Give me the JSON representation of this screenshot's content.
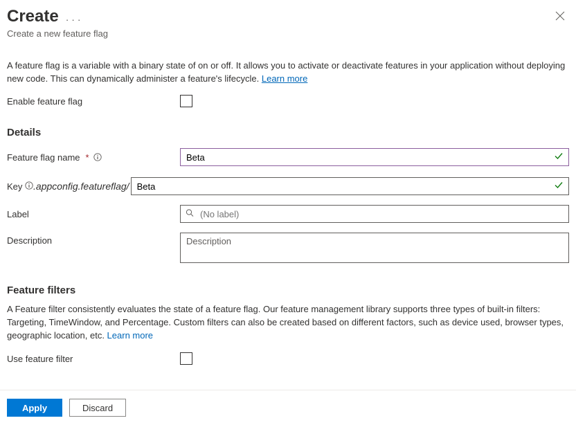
{
  "header": {
    "title": "Create",
    "subtitle": "Create a new feature flag"
  },
  "intro": {
    "text": "A feature flag is a variable with a binary state of on or off. It allows you to activate or deactivate features in your application without deploying new code. This can dynamically administer a feature's lifecycle. ",
    "learn_more": "Learn more"
  },
  "enable": {
    "label": "Enable feature flag"
  },
  "details": {
    "heading": "Details",
    "name": {
      "label": "Feature flag name",
      "value": "Beta"
    },
    "key": {
      "label": "Key",
      "prefix": ".appconfig.featureflag/",
      "value": "Beta"
    },
    "label_field": {
      "label": "Label",
      "placeholder": "(No label)"
    },
    "description": {
      "label": "Description",
      "placeholder": "Description"
    }
  },
  "filters": {
    "heading": "Feature filters",
    "text": "A Feature filter consistently evaluates the state of a feature flag. Our feature management library supports three types of built-in filters: Targeting, TimeWindow, and Percentage. Custom filters can also be created based on different factors, such as device used, browser types, geographic location, etc. ",
    "learn_more": "Learn more",
    "use_label": "Use feature filter"
  },
  "footer": {
    "apply": "Apply",
    "discard": "Discard"
  }
}
